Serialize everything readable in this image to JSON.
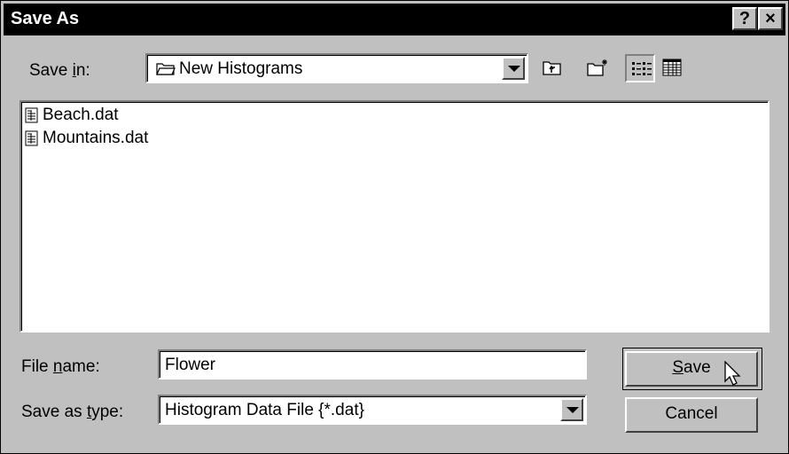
{
  "title": "Save As",
  "titlebar_buttons": {
    "help_label": "?",
    "close_label": "×"
  },
  "save_in": {
    "label_pre": "Save ",
    "label_key": "i",
    "label_post": "n:",
    "value": "New Histograms",
    "icon": "folder-icon"
  },
  "toolbar": [
    {
      "name": "up-one-level-icon"
    },
    {
      "name": "create-new-folder-icon"
    },
    {
      "name": "list-view-icon"
    },
    {
      "name": "details-view-icon"
    }
  ],
  "files": [
    {
      "name": "Beach.dat",
      "icon": "data-file-icon"
    },
    {
      "name": "Mountains.dat",
      "icon": "data-file-icon"
    }
  ],
  "file_name": {
    "label_pre": "File ",
    "label_key": "n",
    "label_post": "ame:",
    "value": "Flower"
  },
  "save_as_type": {
    "label_pre": "Save as ",
    "label_key": "t",
    "label_post": "ype:",
    "value": "Histogram Data File {*.dat}"
  },
  "buttons": {
    "save_key": "S",
    "save_rest": "ave",
    "cancel": "Cancel"
  }
}
